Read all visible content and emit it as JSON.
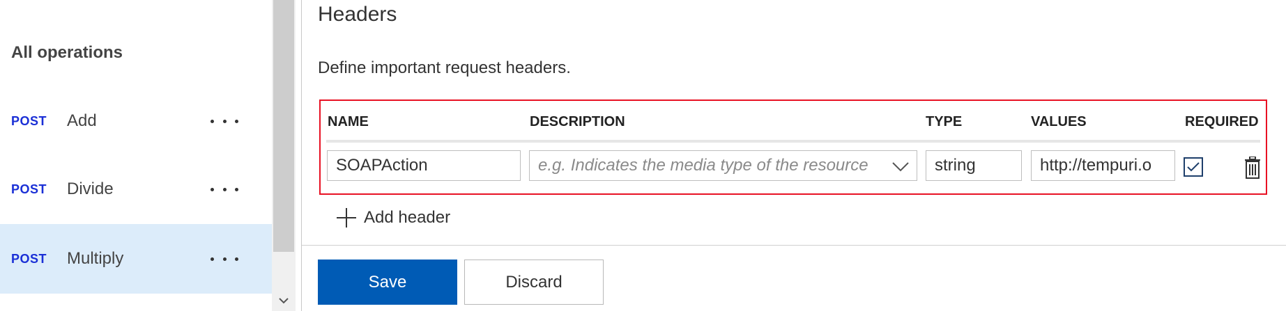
{
  "sidebar": {
    "heading": "All operations",
    "operations": [
      {
        "method": "POST",
        "name": "Add",
        "selected": false
      },
      {
        "method": "POST",
        "name": "Divide",
        "selected": false
      },
      {
        "method": "POST",
        "name": "Multiply",
        "selected": true
      }
    ]
  },
  "headers_section": {
    "title": "Headers",
    "description": "Define important request headers.",
    "columns": {
      "name": "NAME",
      "description": "DESCRIPTION",
      "type": "TYPE",
      "values": "VALUES",
      "required": "REQUIRED"
    },
    "row": {
      "name": "SOAPAction",
      "description_placeholder": "e.g. Indicates the media type of the resource",
      "type": "string",
      "values": "http://tempuri.o",
      "required": true
    },
    "add_header_label": "Add header"
  },
  "actions": {
    "save_label": "Save",
    "discard_label": "Discard"
  },
  "colors": {
    "accent": "#005bb5",
    "method": "#1a2fd6",
    "highlight_border": "#e81123",
    "selected_bg": "#dcecfa"
  }
}
